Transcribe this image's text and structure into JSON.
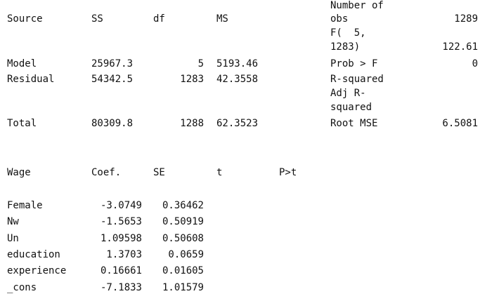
{
  "anova": {
    "headers": {
      "source": "Source",
      "ss": "SS",
      "df": "df",
      "ms": "MS"
    },
    "rows": [
      {
        "source": "Model",
        "ss": "25967.3",
        "df": "5",
        "ms": "5193.46"
      },
      {
        "source": "Residual",
        "ss": "54342.5",
        "df": "1283",
        "ms": "42.3558"
      },
      {
        "source": "Total",
        "ss": "80309.8",
        "df": "1288",
        "ms": "62.3523"
      }
    ]
  },
  "stats": {
    "nobs_label_1": "Number of",
    "nobs_label_2": "obs",
    "nobs_value": "1289",
    "f_label_1": "F(  5,",
    "f_label_2": "1283)",
    "f_value": "122.61",
    "probf_label": "Prob > F",
    "probf_value": "0",
    "rsq_label": "R-squared",
    "adjrsq_label_1": "Adj R-",
    "adjrsq_label_2": "squared",
    "rmse_label": "Root MSE",
    "rmse_value": "6.5081"
  },
  "coef_table": {
    "headers": {
      "var": "Wage",
      "coef": "Coef.",
      "se": "SE",
      "t": "t",
      "p": "P>t"
    },
    "rows": [
      {
        "var": "Female",
        "coef": "-3.0749",
        "se": "0.36462"
      },
      {
        "var": "Nw",
        "coef": "-1.5653",
        "se": "0.50919"
      },
      {
        "var": "Un",
        "coef": "1.09598",
        "se": "0.50608"
      },
      {
        "var": "education",
        "coef": "1.3703",
        "se": "0.0659"
      },
      {
        "var": "experience",
        "coef": "0.16661",
        "se": "0.01605"
      },
      {
        "var": "_cons",
        "coef": "-7.1833",
        "se": "1.01579"
      }
    ]
  }
}
